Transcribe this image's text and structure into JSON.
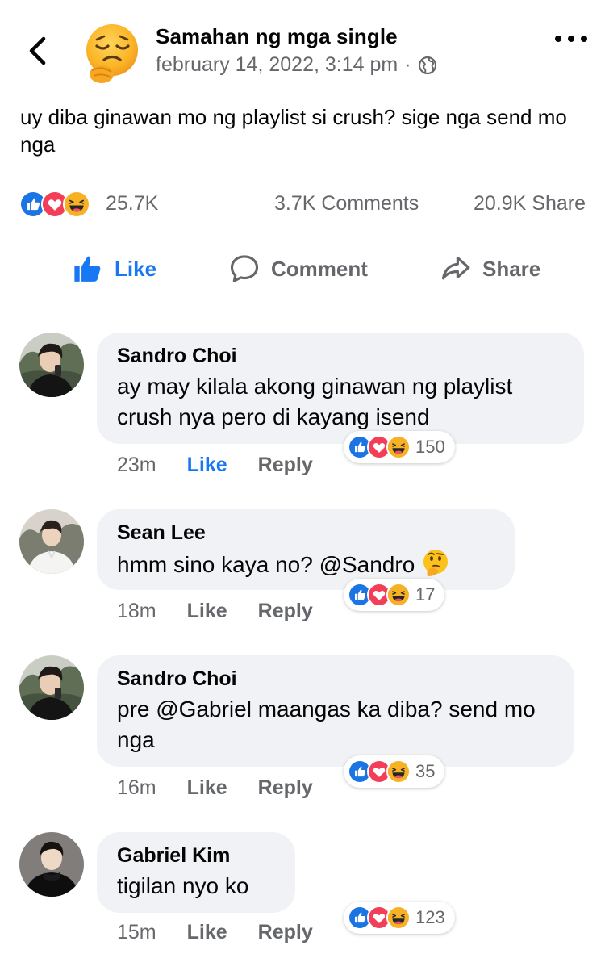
{
  "post": {
    "page_name": "Samahan ng mga single",
    "timestamp": "february 14, 2022, 3:14 pm",
    "separator": "·",
    "audience_icon": "globe-icon",
    "avatar_icon": "tired-face-emoji",
    "text": "uy diba ginawan mo ng playlist si crush? sige nga send mo nga",
    "reactions": [
      "like-reaction-icon",
      "love-reaction-icon",
      "haha-reaction-icon"
    ],
    "reaction_count": "25.7K",
    "comments_count": "3.7K Comments",
    "shares_count": "20.9K Share"
  },
  "actions": {
    "like_label": "Like",
    "comment_label": "Comment",
    "share_label": "Share"
  },
  "colors": {
    "brand_blue": "#1877f2",
    "like_blue": "#1b74e4",
    "love_red": "#f33e58",
    "haha_yellow": "#f7b125",
    "secondary_text": "#65676b",
    "bubble_bg": "#f0f2f5"
  },
  "comments": [
    {
      "author": "Sandro Choi",
      "text": "ay may kilala akong ginawan ng playlist crush nya pero di kayang isend",
      "time": "23m",
      "like_label": "Like",
      "reply_label": "Reply",
      "reaction_count": "150",
      "liked": true
    },
    {
      "author": "Sean Lee",
      "text": "hmm sino kaya no? @Sandro",
      "emoji": "thinking-face-emoji",
      "time": "18m",
      "like_label": "Like",
      "reply_label": "Reply",
      "reaction_count": "17",
      "liked": false
    },
    {
      "author": "Sandro Choi",
      "text": "pre @Gabriel maangas ka diba? send mo nga",
      "time": "16m",
      "like_label": "Like",
      "reply_label": "Reply",
      "reaction_count": "35",
      "liked": false
    },
    {
      "author": "Gabriel Kim",
      "text": "tigilan nyo ko",
      "time": "15m",
      "like_label": "Like",
      "reply_label": "Reply",
      "reaction_count": "123",
      "liked": false
    }
  ]
}
